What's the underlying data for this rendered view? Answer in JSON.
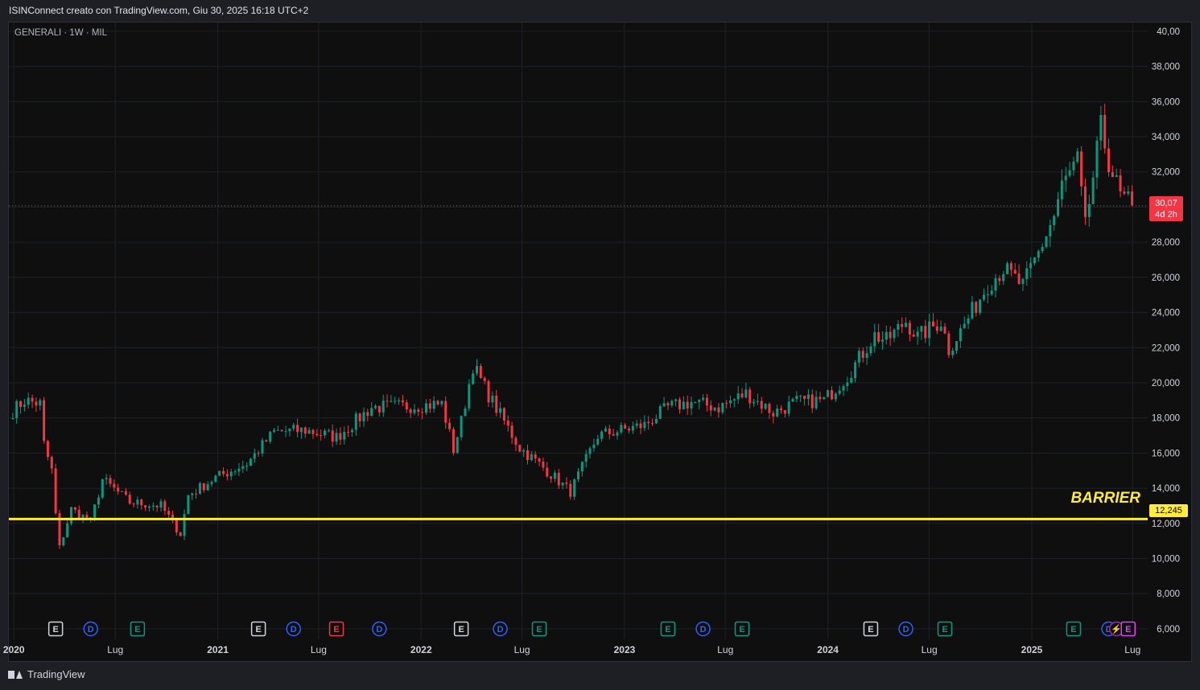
{
  "header": {
    "caption": "ISINConnect creato con TradingView.com, Giu 30, 2025 16:18 UTC+2",
    "symbol": "GENERALI · 1W · MIL"
  },
  "footer": {
    "brand": "TradingView"
  },
  "chart_data": {
    "type": "candlestick",
    "ylim": [
      5.4,
      40.5
    ],
    "y_ticks": [
      "6,000",
      "8,000",
      "10,000",
      "12,000",
      "14,000",
      "16,000",
      "18,000",
      "20,000",
      "22,000",
      "24,000",
      "26,000",
      "28,000",
      "30,000",
      "32,000",
      "34,000",
      "36,000",
      "38,000",
      "40,00"
    ],
    "x_ticks": [
      "2020",
      "Lug",
      "2021",
      "Lug",
      "2022",
      "Lug",
      "2023",
      "Lug",
      "2024",
      "Lug",
      "2025",
      "Lug"
    ],
    "last_price": {
      "value": "30,07",
      "countdown": "4d 2h",
      "level": 30.07,
      "color": "#f23645"
    },
    "barrier": {
      "label": "BARRIER",
      "value": "12,245",
      "level": 12.245,
      "color": "#ffeb3b"
    },
    "colors": {
      "up": "#089981",
      "down": "#f23645",
      "grid": "#1f2126",
      "axis_text": "#d1d4dc"
    },
    "anchors": [
      [
        "2019-12-30",
        18.4
      ],
      [
        "2020-01-20",
        19.0
      ],
      [
        "2020-02-17",
        18.8
      ],
      [
        "2020-02-24",
        16.5
      ],
      [
        "2020-03-09",
        15.0
      ],
      [
        "2020-03-16",
        12.5
      ],
      [
        "2020-03-23",
        10.6
      ],
      [
        "2020-04-13",
        12.8
      ],
      [
        "2020-05-18",
        12.1
      ],
      [
        "2020-06-08",
        14.5
      ],
      [
        "2020-07-27",
        13.2
      ],
      [
        "2020-09-21",
        13.0
      ],
      [
        "2020-10-26",
        11.4
      ],
      [
        "2020-11-09",
        13.6
      ],
      [
        "2020-12-28",
        14.6
      ],
      [
        "2021-02-22",
        15.4
      ],
      [
        "2021-04-12",
        17.2
      ],
      [
        "2021-06-07",
        17.3
      ],
      [
        "2021-08-02",
        16.9
      ],
      [
        "2021-10-04",
        18.6
      ],
      [
        "2021-12-27",
        18.7
      ],
      [
        "2022-02-07",
        18.8
      ],
      [
        "2022-02-28",
        16.2
      ],
      [
        "2022-03-14",
        17.8
      ],
      [
        "2022-04-04",
        21.0
      ],
      [
        "2022-05-02",
        19.3
      ],
      [
        "2022-05-30",
        17.8
      ],
      [
        "2022-06-27",
        16.3
      ],
      [
        "2022-08-22",
        14.8
      ],
      [
        "2022-09-26",
        13.8
      ],
      [
        "2022-11-14",
        17.0
      ],
      [
        "2023-02-06",
        17.6
      ],
      [
        "2023-03-20",
        18.6
      ],
      [
        "2023-05-01",
        18.9
      ],
      [
        "2023-06-19",
        18.6
      ],
      [
        "2023-08-07",
        19.4
      ],
      [
        "2023-09-25",
        18.3
      ],
      [
        "2023-11-06",
        18.9
      ],
      [
        "2023-12-25",
        19.0
      ],
      [
        "2024-02-05",
        20.4
      ],
      [
        "2024-03-25",
        22.7
      ],
      [
        "2024-04-15",
        22.4
      ],
      [
        "2024-05-20",
        23.5
      ],
      [
        "2024-06-10",
        22.6
      ],
      [
        "2024-07-22",
        23.5
      ],
      [
        "2024-08-05",
        21.9
      ],
      [
        "2024-09-02",
        23.3
      ],
      [
        "2024-10-14",
        25.6
      ],
      [
        "2024-11-11",
        26.5
      ],
      [
        "2024-12-16",
        25.5
      ],
      [
        "2025-01-13",
        27.4
      ],
      [
        "2025-02-10",
        29.5
      ],
      [
        "2025-02-24",
        31.2
      ],
      [
        "2025-03-24",
        32.6
      ],
      [
        "2025-04-07",
        28.8
      ],
      [
        "2025-04-21",
        31.7
      ],
      [
        "2025-05-05",
        34.5
      ],
      [
        "2025-05-19",
        32.6
      ],
      [
        "2025-06-09",
        30.6
      ],
      [
        "2025-06-30",
        30.1
      ]
    ],
    "event_markers": [
      {
        "date": "2020-03-16",
        "type": "E",
        "color": "#d1d4dc"
      },
      {
        "date": "2020-05-18",
        "type": "D",
        "color": "#2962ff"
      },
      {
        "date": "2020-08-10",
        "type": "E",
        "color": "#089981"
      },
      {
        "date": "2021-03-15",
        "type": "E",
        "color": "#d1d4dc"
      },
      {
        "date": "2021-05-17",
        "type": "D",
        "color": "#2962ff"
      },
      {
        "date": "2021-08-02",
        "type": "E",
        "color": "#f23645"
      },
      {
        "date": "2021-10-18",
        "type": "D",
        "color": "#2962ff"
      },
      {
        "date": "2022-03-14",
        "type": "E",
        "color": "#d1d4dc"
      },
      {
        "date": "2022-05-23",
        "type": "D",
        "color": "#2962ff"
      },
      {
        "date": "2022-08-01",
        "type": "E",
        "color": "#089981"
      },
      {
        "date": "2023-03-20",
        "type": "E",
        "color": "#089981"
      },
      {
        "date": "2023-05-22",
        "type": "D",
        "color": "#2962ff"
      },
      {
        "date": "2023-07-31",
        "type": "E",
        "color": "#089981"
      },
      {
        "date": "2024-03-18",
        "type": "E",
        "color": "#d1d4dc"
      },
      {
        "date": "2024-05-20",
        "type": "D",
        "color": "#2962ff"
      },
      {
        "date": "2024-07-29",
        "type": "E",
        "color": "#089981"
      },
      {
        "date": "2025-03-17",
        "type": "E",
        "color": "#089981"
      },
      {
        "date": "2025-05-19",
        "type": "D",
        "color": "#2962ff"
      },
      {
        "date": "2025-06-02",
        "type": "⚡",
        "color": "#9c27b0"
      },
      {
        "date": "2025-06-23",
        "type": "E",
        "color": "#e040fb"
      }
    ]
  }
}
